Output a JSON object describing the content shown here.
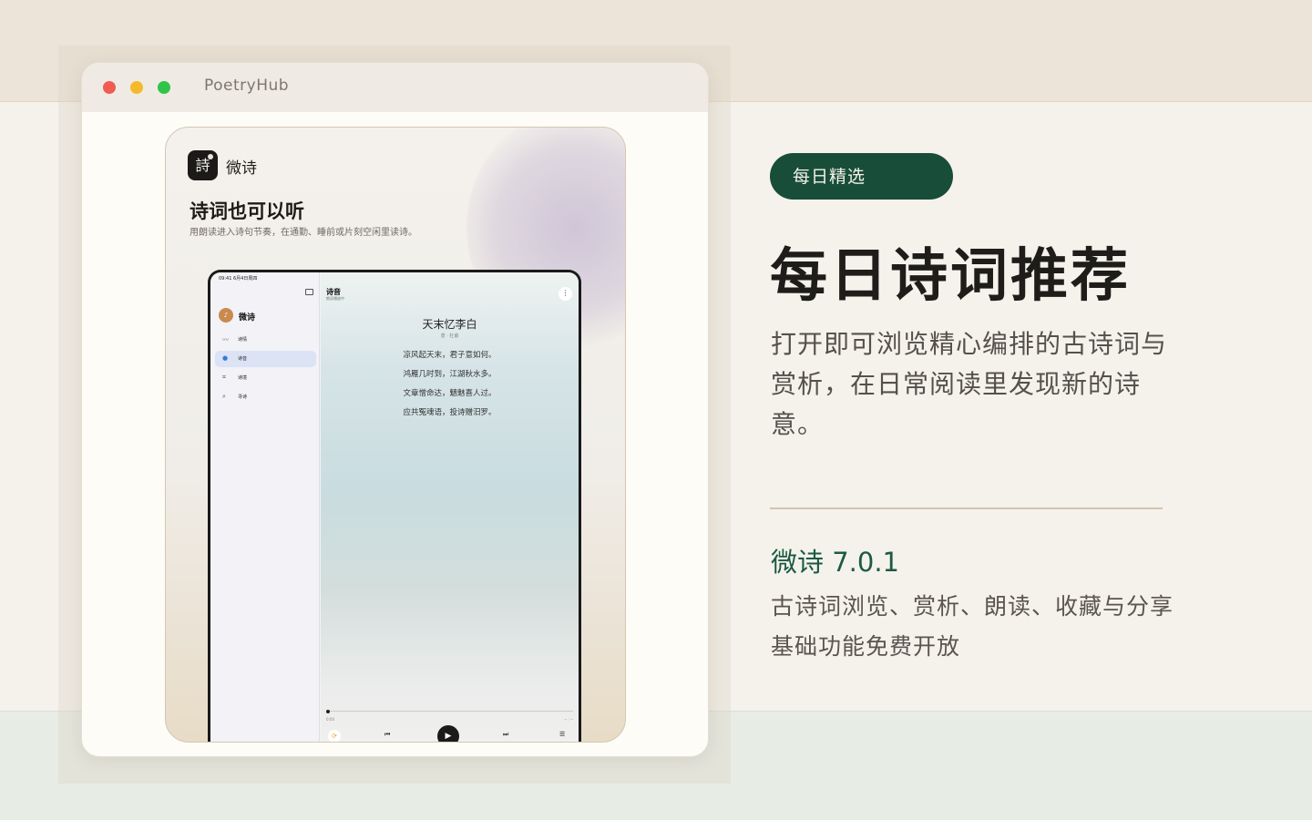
{
  "window": {
    "title": "PoetryHub"
  },
  "card": {
    "app_icon_glyph": "詩",
    "app_name": "微诗",
    "headline": "诗词也可以听",
    "subtitle": "用朗读进入诗句节奏，在通勤、睡前或片刻空闲里读诗。"
  },
  "ipad": {
    "status_time": "09:41  6月4日周四",
    "sidebar": {
      "app_name": "微诗",
      "items": [
        {
          "icon": "wave-icon",
          "label": "诗情"
        },
        {
          "icon": "audio-icon",
          "label": "诗音"
        },
        {
          "icon": "scan-icon",
          "label": "诗境"
        },
        {
          "icon": "search-icon",
          "label": "寻诗"
        }
      ]
    },
    "main": {
      "title": "诗音",
      "subtitle": "朗读播放中",
      "more_glyph": "⋮",
      "poem": {
        "title": "天末忆李白",
        "author": "唐 · 杜甫",
        "lines": [
          "凉风起天末，君子意如何。",
          "鸿雁几时到，江湖秋水多。",
          "文章憎命达，魑魅喜人过。",
          "应共冤魂语，投诗赠汨罗。"
        ]
      },
      "player": {
        "progress": 0.0,
        "time_elapsed": "0:00",
        "time_remaining": "-- : --",
        "repeat_glyph": "⟳",
        "prev_glyph": "⏮",
        "play_glyph": "▶",
        "next_glyph": "⏭",
        "list_glyph": "☰"
      }
    }
  },
  "promo": {
    "tag": "每日精选",
    "headline": "每日诗词推荐",
    "description": "打开即可浏览精心编排的古诗词与赏析，在日常阅读里发现新的诗意。",
    "version": "微诗 7.0.1",
    "features": [
      "古诗词浏览、赏析、朗读、收藏与分享",
      "基础功能免费开放"
    ]
  },
  "colors": {
    "accent_green": "#184d3a",
    "version_green": "#1c5a43",
    "top_band": "#ece4d8",
    "bottom_band": "#e7ece5"
  }
}
